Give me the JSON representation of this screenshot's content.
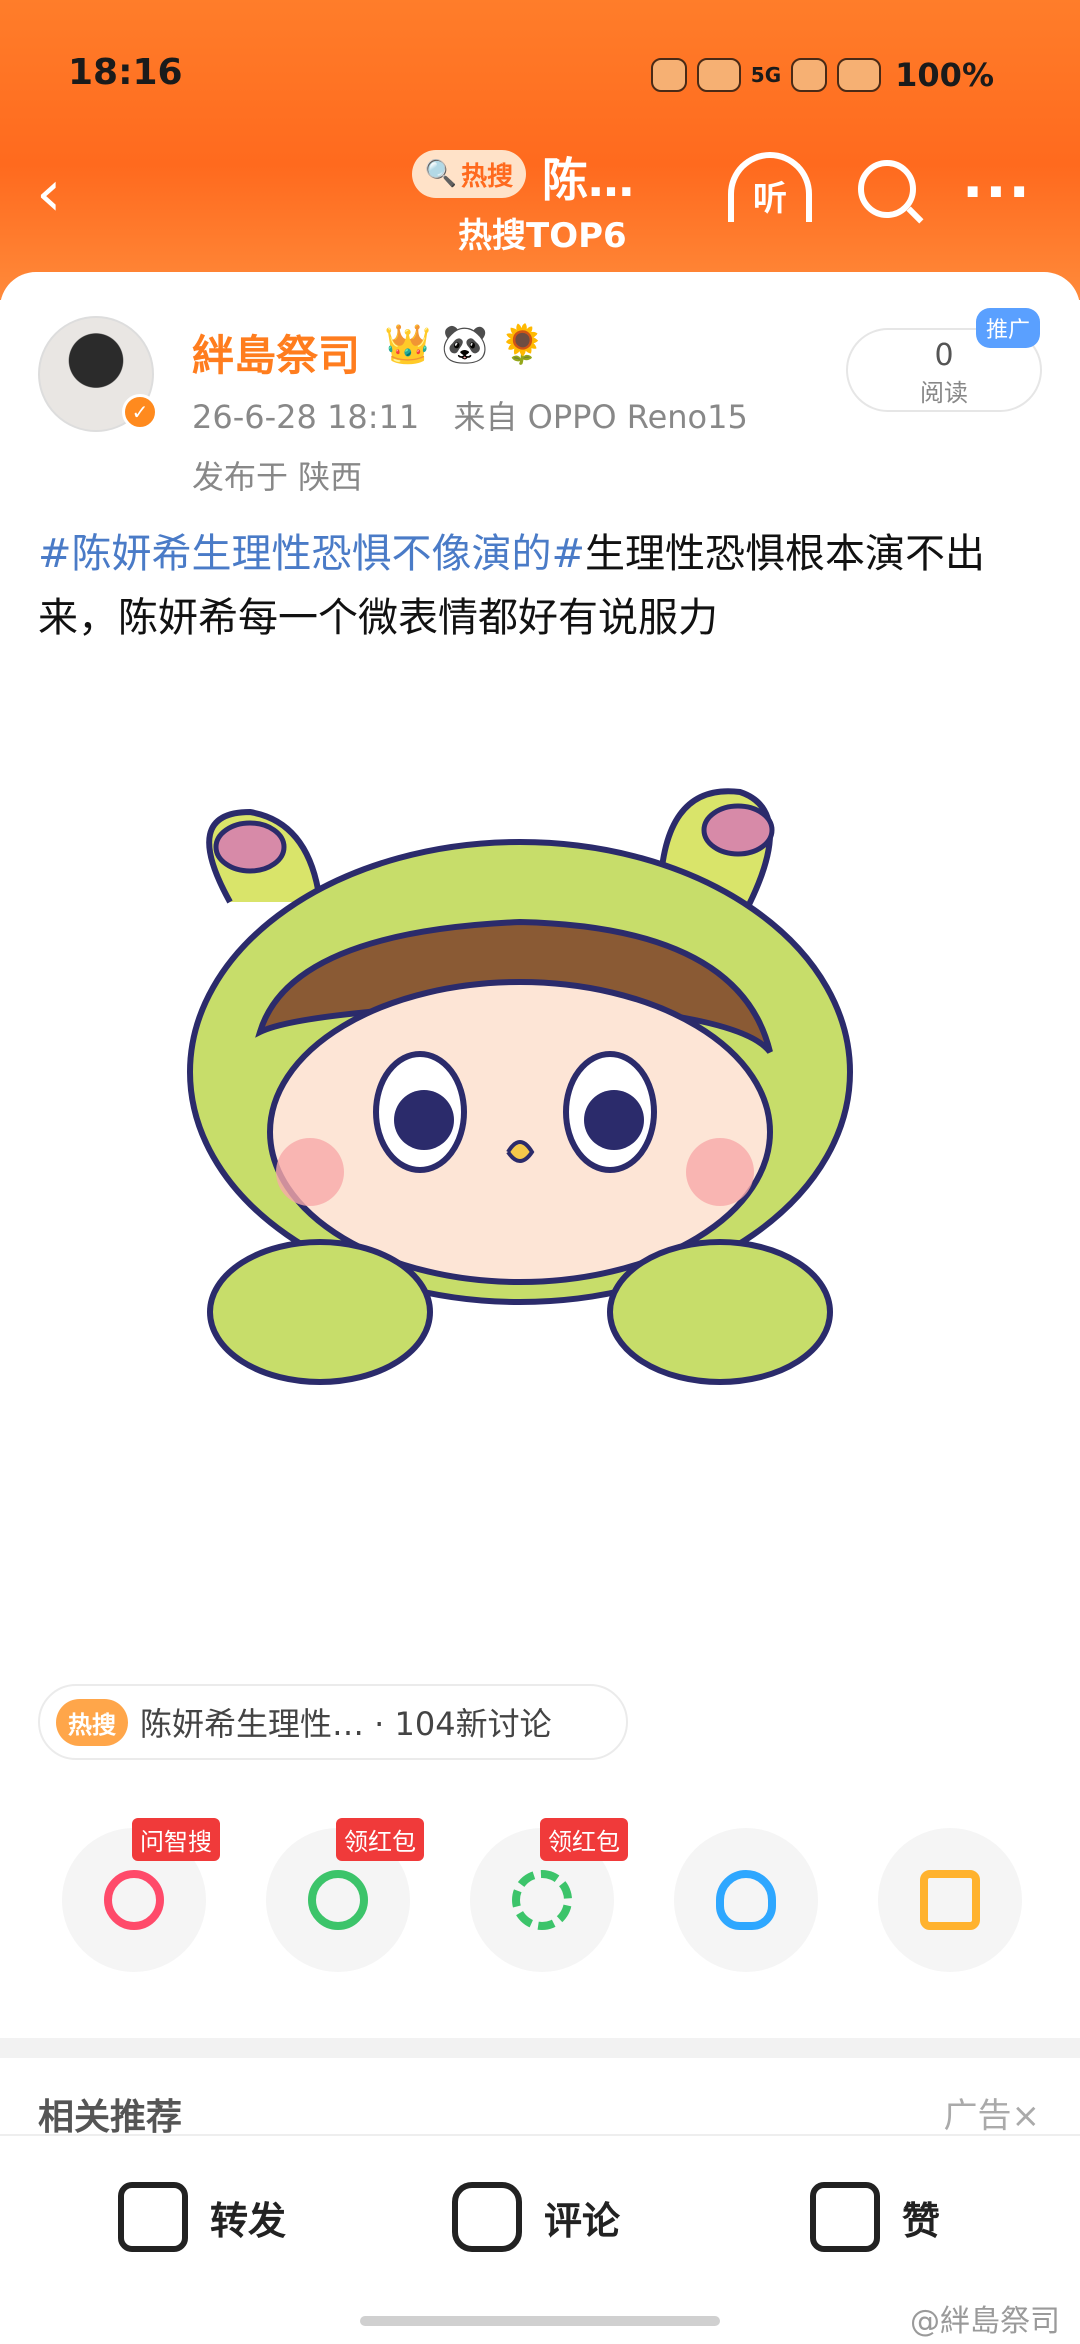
{
  "status_bar": {
    "time": "18:16",
    "network": "5G",
    "battery": "100%"
  },
  "nav": {
    "back": "‹",
    "hot_label": "热搜",
    "title": "陈…",
    "subtitle": "热搜TOP6",
    "listen": "听",
    "more": "···"
  },
  "post": {
    "author": "絆島祭司",
    "badges": [
      "👑",
      "🐼",
      "🌻"
    ],
    "datetime": "26-6-28 18:11",
    "source": "来自 OPPO Reno15",
    "location": "发布于 陕西",
    "read_count": "0",
    "read_label": "阅读",
    "promo_tag": "推广",
    "hashtag": "#陈妍希生理性恐惧不像演的#",
    "text": "生理性恐惧根本演不出来，陈妍希每一个微表情都好有说服力"
  },
  "topic_chip": {
    "hot_label": "热搜",
    "text": "陈妍希生理性… · 104新讨论"
  },
  "share_targets": [
    {
      "name": "wenzhisou",
      "badge": "问智搜",
      "color": "#ff4a6a"
    },
    {
      "name": "wechat",
      "badge": "领红包",
      "color": "#3cc46a"
    },
    {
      "name": "moments",
      "badge": "领红包",
      "color": "#3cc46a"
    },
    {
      "name": "qq",
      "badge": "",
      "color": "#2ea7ff"
    },
    {
      "name": "save-image",
      "badge": "",
      "color": "#ffb22e"
    }
  ],
  "related": {
    "title": "相关推荐",
    "ad_label": "广告",
    "close": "×"
  },
  "actions": {
    "repost": "转发",
    "comment": "评论",
    "like": "赞"
  },
  "watermark": "@絆島祭司"
}
